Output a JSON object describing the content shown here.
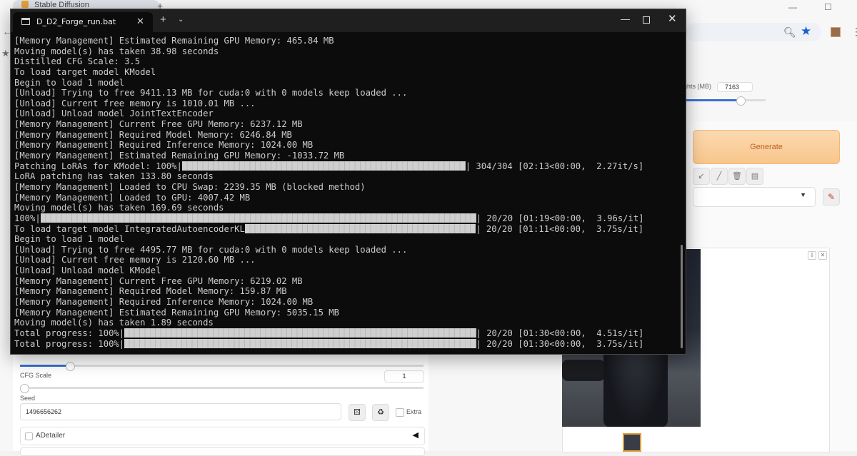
{
  "browser": {
    "tab_title": "Stable Diffusion",
    "new_tab": "+",
    "weights_label": "ights (MB)",
    "weights_value": "7163",
    "generate_label": "Generate",
    "cfg_label": "CFG Scale",
    "cfg_value": "1",
    "seed_label": "Seed",
    "seed_value": "1496656262",
    "extra_label": "Extra",
    "adetailer_label": "ADetailer",
    "icons": [
      "back-icon",
      "zoom-icon",
      "star-icon",
      "extension-icon",
      "menu-icon",
      "bookmark-star-icon",
      "dice-icon",
      "recycle-icon",
      "pen-icon",
      "brush-icon",
      "trash-icon",
      "clipboard-icon",
      "download-icon",
      "close-icon"
    ]
  },
  "terminal": {
    "tab_title": "D_D2_Forge_run.bat",
    "new_tab": "+",
    "dropdown": "⌄",
    "lines": [
      {
        "text": "[Memory Management] Estimated Remaining GPU Memory: 465.84 MB"
      },
      {
        "text": "Moving model(s) has taken 38.98 seconds"
      },
      {
        "text": "Distilled CFG Scale: 3.5"
      },
      {
        "text": "To load target model KModel"
      },
      {
        "text": "Begin to load 1 model"
      },
      {
        "text": "[Unload] Trying to free 9411.13 MB for cuda:0 with 0 models keep loaded ..."
      },
      {
        "text": "[Unload] Current free memory is 1010.01 MB ..."
      },
      {
        "text": "[Unload] Unload model JointTextEncoder"
      },
      {
        "text": "[Memory Management] Current Free GPU Memory: 6237.12 MB"
      },
      {
        "text": "[Memory Management] Required Model Memory: 6246.84 MB"
      },
      {
        "text": "[Memory Management] Required Inference Memory: 1024.00 MB"
      },
      {
        "text": "[Memory Management] Estimated Remaining GPU Memory: -1033.72 MB"
      },
      {
        "text": "Patching LoRAs for KModel: 100%|",
        "bar_chars": 54,
        "tail": "| 304/304 [02:13<00:00,  2.27it/s]"
      },
      {
        "text": "LoRA patching has taken 133.80 seconds"
      },
      {
        "text": "[Memory Management] Loaded to CPU Swap: 2239.35 MB (blocked method)"
      },
      {
        "text": "[Memory Management] Loaded to GPU: 4007.42 MB"
      },
      {
        "text": "Moving model(s) has taken 169.69 seconds"
      },
      {
        "text": "100%|",
        "bar_chars": 83,
        "tail": "| 20/20 [01:19<00:00,  3.96s/it]"
      },
      {
        "text": "To load target model IntegratedAutoencoderKL",
        "bar_chars": 44,
        "tail": "| 20/20 [01:11<00:00,  3.75s/it]"
      },
      {
        "text": "Begin to load 1 model"
      },
      {
        "text": "[Unload] Trying to free 4495.77 MB for cuda:0 with 0 models keep loaded ..."
      },
      {
        "text": "[Unload] Current free memory is 2120.60 MB ..."
      },
      {
        "text": "[Unload] Unload model KModel"
      },
      {
        "text": "[Memory Management] Current Free GPU Memory: 6219.02 MB"
      },
      {
        "text": "[Memory Management] Required Model Memory: 159.87 MB"
      },
      {
        "text": "[Memory Management] Required Inference Memory: 1024.00 MB"
      },
      {
        "text": "[Memory Management] Estimated Remaining GPU Memory: 5035.15 MB"
      },
      {
        "text": "Moving model(s) has taken 1.89 seconds"
      },
      {
        "text": "Total progress: 100%|",
        "bar_chars": 67,
        "tail": "| 20/20 [01:30<00:00,  4.51s/it]"
      },
      {
        "text": "Total progress: 100%|",
        "bar_chars": 67,
        "tail": "| 20/20 [01:30<00:00,  3.75s/it]"
      }
    ]
  }
}
